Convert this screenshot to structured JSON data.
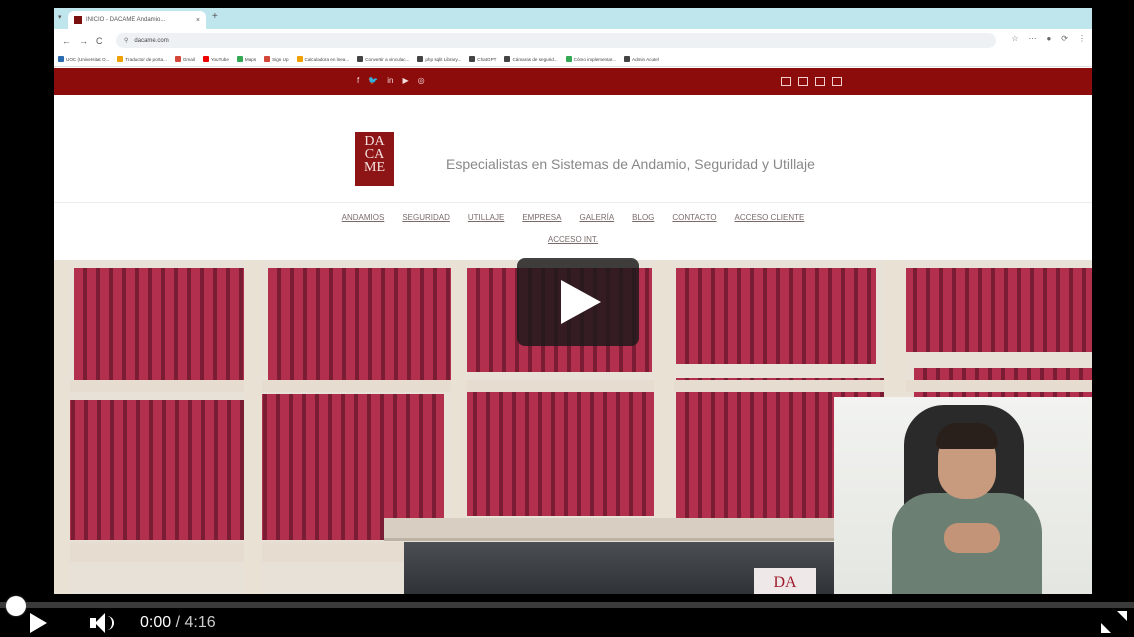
{
  "browser": {
    "tab_title": "INICIO - DACAME Andamio...",
    "tab_close": "×",
    "new_tab": "+",
    "tab_menu": "▾",
    "back": "←",
    "forward": "→",
    "reload": "C",
    "url": "dacame.com",
    "toolbar_icons": [
      "☆",
      "⋯",
      "●",
      "⟳",
      "⋮"
    ],
    "bookmarks": [
      {
        "label": "UOC (Universitat O...",
        "color": "#2b6cb0"
      },
      {
        "label": "Traductor de porta...",
        "color": "#f0a000"
      },
      {
        "label": "Gmail",
        "color": "#d44638"
      },
      {
        "label": "YouTube",
        "color": "#e00"
      },
      {
        "label": "Maps",
        "color": "#34a853"
      },
      {
        "label": "Sign Up",
        "color": "#d44638"
      },
      {
        "label": "Calculadora en lnea...",
        "color": "#f0a000"
      },
      {
        "label": "Convertir a vinculac...",
        "color": "#444"
      },
      {
        "label": "php sqlit Library...",
        "color": "#444"
      },
      {
        "label": "ChatGPT",
        "color": "#444"
      },
      {
        "label": "Cámaras de segurid...",
        "color": "#444"
      },
      {
        "label": "Cómo implementar...",
        "color": "#34a853"
      },
      {
        "label": "Admin Acutel",
        "color": "#444"
      }
    ]
  },
  "site": {
    "social_icons": [
      "f",
      "🐦",
      "in",
      "▶",
      "◎"
    ],
    "logo_text": "DA CA ME",
    "tagline": "Especialistas en Sistemas de Andamio, Seguridad y Utillaje",
    "nav_row1": [
      "ANDAMIOS",
      "SEGURIDAD",
      "UTILLAJE",
      "EMPRESA",
      "GALERÍA",
      "BLOG",
      "CONTACTO",
      "ACCESO CLIENTE"
    ],
    "nav_row2": [
      "ACCESO INT."
    ],
    "building_logo": "DA"
  },
  "player": {
    "current_time": "0:00",
    "duration": "/ 4:16",
    "progress_fraction": 0.0
  }
}
